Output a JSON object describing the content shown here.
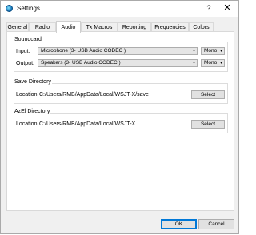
{
  "window": {
    "title": "Settings",
    "help": "?",
    "close": "✕"
  },
  "tabs": [
    {
      "label": "General"
    },
    {
      "label": "Radio"
    },
    {
      "label": "Audio"
    },
    {
      "label": "Tx Macros"
    },
    {
      "label": "Reporting"
    },
    {
      "label": "Frequencies"
    },
    {
      "label": "Colors"
    }
  ],
  "soundcard": {
    "title": "Soundcard",
    "input_label": "Input:",
    "input_value": "Microphone (3- USB Audio CODEC )",
    "input_channel": "Mono",
    "output_label": "Output:",
    "output_value": "Speakers (3- USB Audio CODEC )",
    "output_channel": "Mono"
  },
  "save_dir": {
    "title": "Save Directory",
    "location_label": "Location:",
    "location_value": "C:/Users/RMB/AppData/Local/WSJT-X/save",
    "select_label": "Select"
  },
  "azel_dir": {
    "title": "AzEl Directory",
    "location_label": "Location:",
    "location_value": "C:/Users/RMB/AppData/Local/WSJT-X",
    "select_label": "Select"
  },
  "footer": {
    "ok": "OK",
    "cancel": "Cancel"
  },
  "icons": {
    "dropdown": "▾"
  }
}
